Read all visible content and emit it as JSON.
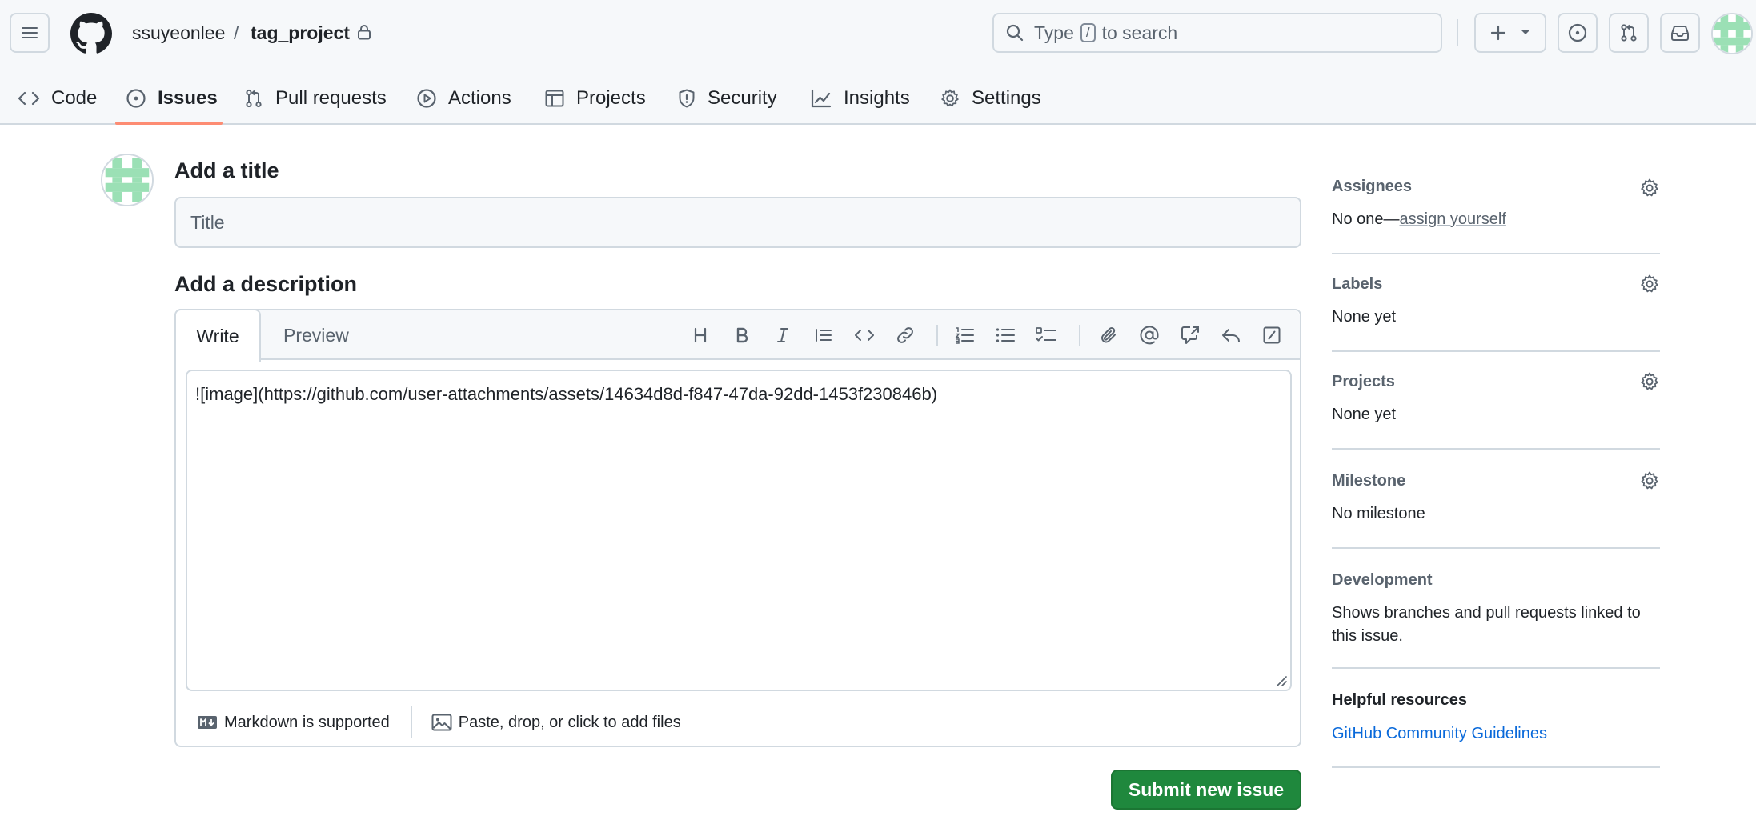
{
  "repo": {
    "owner": "ssuyeonlee",
    "separator": "/",
    "name": "tag_project"
  },
  "search": {
    "prefix": "Type",
    "key": "/",
    "suffix": "to search"
  },
  "nav": {
    "items": [
      {
        "label": "Code",
        "icon": "code-icon"
      },
      {
        "label": "Issues",
        "icon": "issue-opened-icon",
        "active": true
      },
      {
        "label": "Pull requests",
        "icon": "git-pull-request-icon"
      },
      {
        "label": "Actions",
        "icon": "play-icon"
      },
      {
        "label": "Projects",
        "icon": "table-icon"
      },
      {
        "label": "Security",
        "icon": "shield-icon"
      },
      {
        "label": "Insights",
        "icon": "graph-icon"
      },
      {
        "label": "Settings",
        "icon": "gear-icon"
      }
    ]
  },
  "form": {
    "title_heading": "Add a title",
    "title_placeholder": "Title",
    "title_value": "",
    "description_heading": "Add a description",
    "tabs": {
      "write": "Write",
      "preview": "Preview"
    },
    "body_value": "![image](https://github.com/user-attachments/assets/14634d8d-f847-47da-92dd-1453f230846b)",
    "markdown_note": "Markdown is supported",
    "attach_note": "Paste, drop, or click to add files",
    "submit_label": "Submit new issue"
  },
  "sidebar": {
    "assignees": {
      "title": "Assignees",
      "value_prefix": "No one—",
      "value_link": "assign yourself"
    },
    "labels": {
      "title": "Labels",
      "value": "None yet"
    },
    "projects": {
      "title": "Projects",
      "value": "None yet"
    },
    "milestone": {
      "title": "Milestone",
      "value": "No milestone"
    },
    "development": {
      "title": "Development",
      "value": "Shows branches and pull requests linked to this issue."
    },
    "helpful": {
      "title": "Helpful resources",
      "link": "GitHub Community Guidelines"
    }
  },
  "colors": {
    "accent_tab_underline": "#fd8c73",
    "submit_green": "#1f883d",
    "link_blue": "#0969da",
    "avatar_green": "#9be0b5"
  }
}
